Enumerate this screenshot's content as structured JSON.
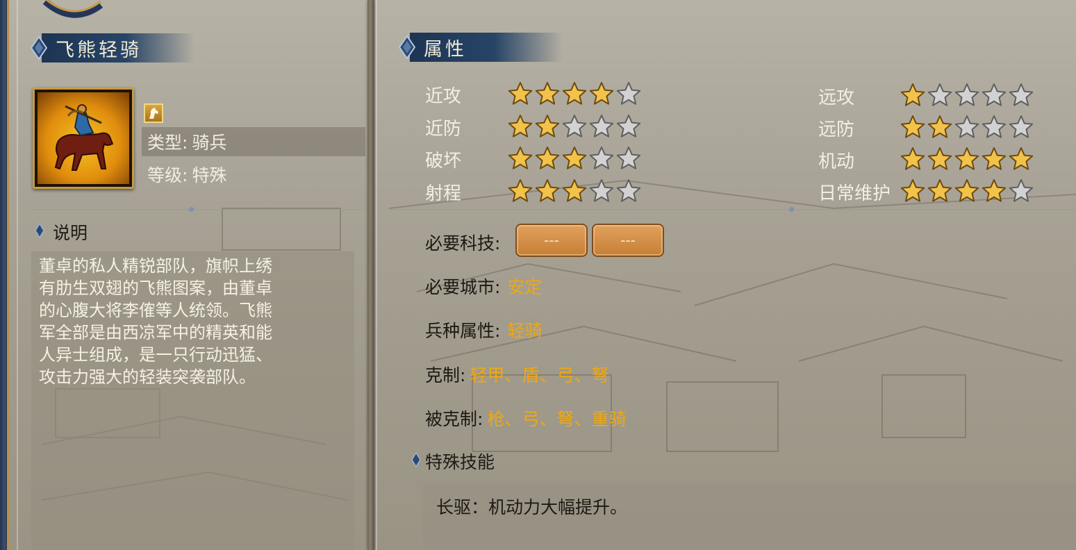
{
  "colors": {
    "accent_value": "#efa810",
    "title_bar": "#1d3554",
    "star_filled": "#f2c24b",
    "star_empty": "#d2d2d2",
    "tech_button": "#c67f36"
  },
  "unit": {
    "name": "飞熊轻骑",
    "class_icon": "horse-head-icon",
    "type_label": "类型:",
    "type_value": "骑兵",
    "grade_label": "等级:",
    "grade_value": "特殊"
  },
  "description": {
    "header": "说明",
    "text": "董卓的私人精锐部队，旗帜上绣\n有肋生双翅的飞熊图案，由董卓\n的心腹大将李傕等人统领。飞熊\n军全部是由西凉军中的精英和能\n人异士组成，是一只行动迅猛、\n攻击力强大的轻装突袭部队。"
  },
  "attributes": {
    "header": "属性",
    "max_stars": 5,
    "stats": [
      {
        "label": "近攻",
        "stars": 4
      },
      {
        "label": "近防",
        "stars": 2
      },
      {
        "label": "破坏",
        "stars": 3
      },
      {
        "label": "射程",
        "stars": 3
      },
      {
        "label": "远攻",
        "stars": 1
      },
      {
        "label": "远防",
        "stars": 2
      },
      {
        "label": "机动",
        "stars": 5
      },
      {
        "label": "日常维护",
        "stars": 4
      }
    ]
  },
  "requirements": {
    "tech_label": "必要科技:",
    "tech_slots": [
      "---",
      "---"
    ],
    "city_label": "必要城市:",
    "city_value": "安定",
    "troop_attr_label": "兵种属性:",
    "troop_attr_value": "轻骑",
    "counters_label": "克制:",
    "counters_value": "轻甲、盾、弓、弩",
    "countered_by_label": "被克制:",
    "countered_by_value": "枪、弓、弩、重骑"
  },
  "special_skill": {
    "header": "特殊技能",
    "text": "长驱：机动力大幅提升。"
  }
}
